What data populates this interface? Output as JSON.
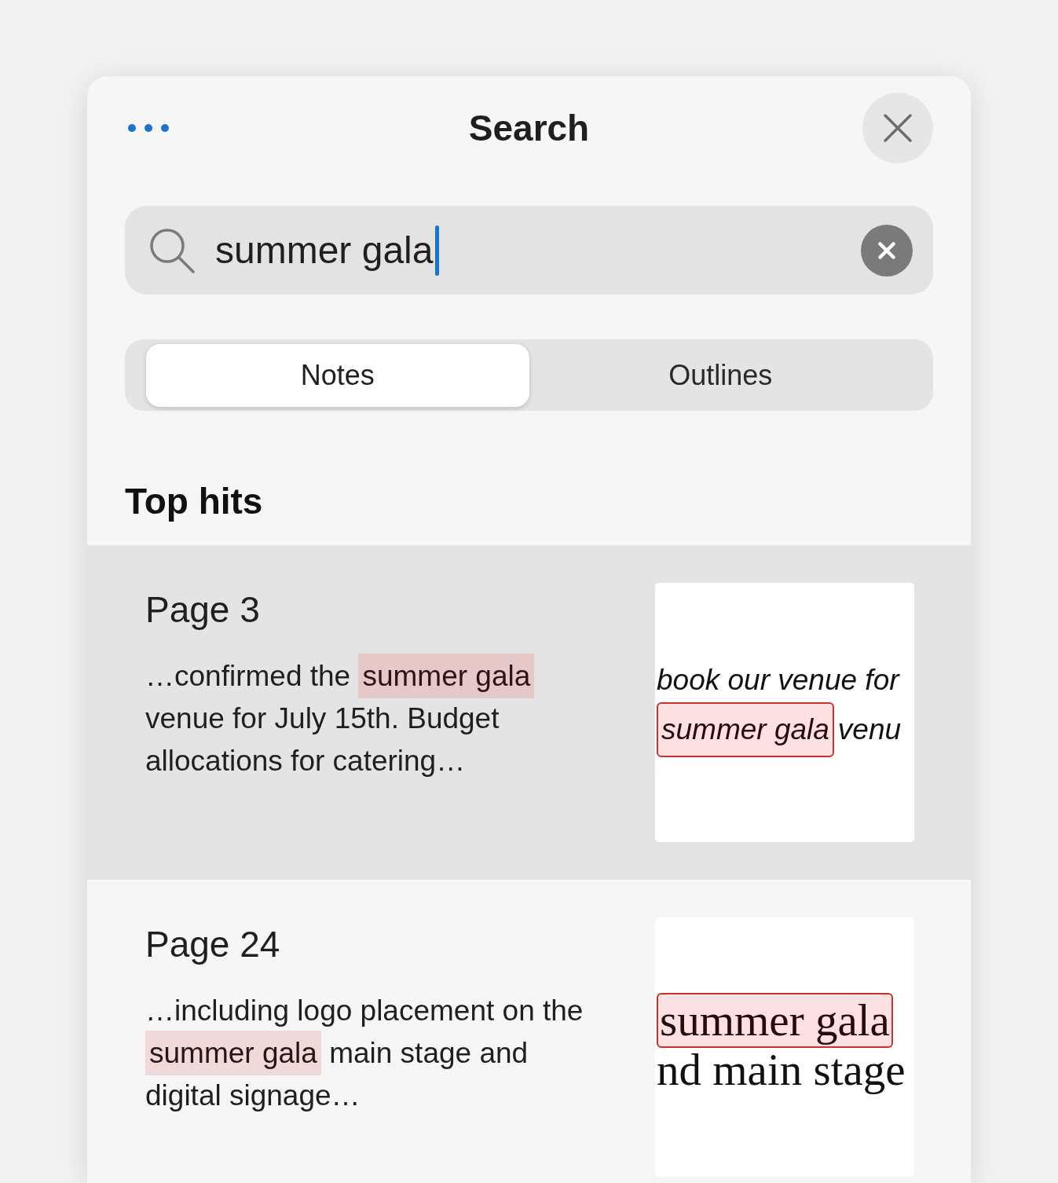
{
  "window": {
    "title": "Search"
  },
  "search": {
    "value": "summer gala",
    "focused": true
  },
  "tabs": [
    {
      "label": "Notes",
      "selected": true
    },
    {
      "label": "Outlines",
      "selected": false
    }
  ],
  "section_title": "Top hits",
  "results": [
    {
      "page": "Page 3",
      "selected": true,
      "snippet": [
        {
          "text": "…confirmed the ",
          "highlighted": false
        },
        {
          "text": "summer gala",
          "highlighted": true
        },
        {
          "text": " venue for July 15th. Budget allocations for catering…",
          "highlighted": false
        }
      ],
      "thumbnail": {
        "kind": "handwriting",
        "lines": [
          {
            "segments": [
              {
                "text": "book our venue for",
                "highlighted": false
              }
            ]
          },
          {
            "segments": [
              {
                "text": "summer gala",
                "highlighted": true
              },
              {
                "text": "venu",
                "highlighted": false
              }
            ]
          }
        ]
      }
    },
    {
      "page": "Page 24",
      "selected": false,
      "snippet": [
        {
          "text": "…including logo placement on the ",
          "highlighted": false
        },
        {
          "text": "summer gala",
          "highlighted": true
        },
        {
          "text": " main stage and digital signage…",
          "highlighted": false
        }
      ],
      "thumbnail": {
        "kind": "typed",
        "lines": [
          {
            "segments": [
              {
                "text": "summer gala",
                "highlighted": true
              }
            ]
          },
          {
            "segments": [
              {
                "text": "nd main stage",
                "highlighted": false
              }
            ]
          }
        ]
      }
    }
  ]
}
